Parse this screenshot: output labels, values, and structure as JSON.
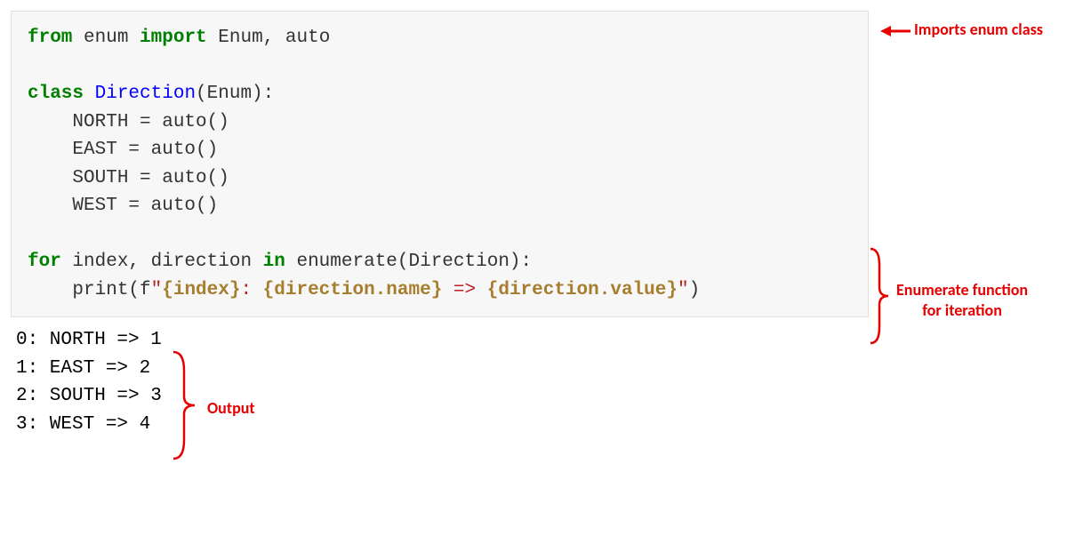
{
  "code": {
    "l1": {
      "t1": "from",
      "t2": " enum ",
      "t3": "import",
      "t4": " Enum, auto"
    },
    "l3": {
      "t1": "class",
      "t2": " ",
      "t3": "Direction",
      "t4": "(Enum):"
    },
    "l4": "    NORTH = auto()",
    "l5": "    EAST = auto()",
    "l6": "    SOUTH = auto()",
    "l7": "    WEST = auto()",
    "l9": {
      "t1": "for",
      "t2": " index, direction ",
      "t3": "in",
      "t4": " enumerate(Direction):"
    },
    "l10": {
      "indent": "    print(f",
      "q1": "\"",
      "i1": "{index}",
      "s1": ": ",
      "i2": "{direction.name}",
      "s2": " => ",
      "i3": "{direction.value}",
      "q2": "\"",
      "close": ")"
    }
  },
  "output": {
    "l1": "0: NORTH => 1",
    "l2": "1: EAST => 2",
    "l3": "2: SOUTH => 3",
    "l4": "3: WEST => 4"
  },
  "annotations": {
    "imports": "Imports enum class",
    "enumerate1": "Enumerate function",
    "enumerate2": "for iteration",
    "output": "Output"
  },
  "colors": {
    "annotation": "#e60000"
  }
}
